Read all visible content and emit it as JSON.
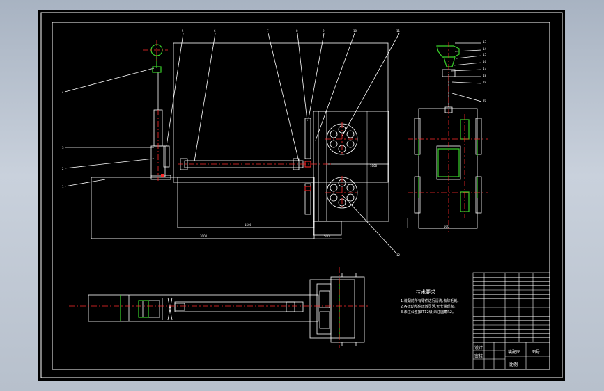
{
  "colors": {
    "background": "#b9c2ce",
    "sheet": "#000000",
    "line": "#ffffff",
    "center_line": "#ff2a2a",
    "green_part": "#39d12a",
    "text": "#ffffff"
  },
  "part_labels": {
    "front": [
      "1",
      "2",
      "3",
      "4",
      "5",
      "6",
      "7",
      "8",
      "9",
      "10",
      "11",
      "12"
    ],
    "side": [
      "13",
      "14",
      "15",
      "16",
      "17",
      "18",
      "19",
      "20"
    ]
  },
  "dimensions": {
    "front_width_total": "3000",
    "front_width_inner": "1500",
    "front_offset": "500",
    "side_width": "500",
    "front_height": "1000"
  },
  "technical_requirements": {
    "heading": "技术要求",
    "lines": [
      "1.装配前所有零件进行清洗,去除毛刺。",
      "2.各运动部件运转灵活,无卡滞现象。",
      "3.未注公差按IT12级,未注圆角R2。"
    ]
  },
  "title_block": {
    "name": "装配图",
    "unit": "图号",
    "designer": "设计",
    "checker": "审核",
    "scale": "比例"
  },
  "icons": {
    "drawing": "cad-drawing-icon"
  }
}
